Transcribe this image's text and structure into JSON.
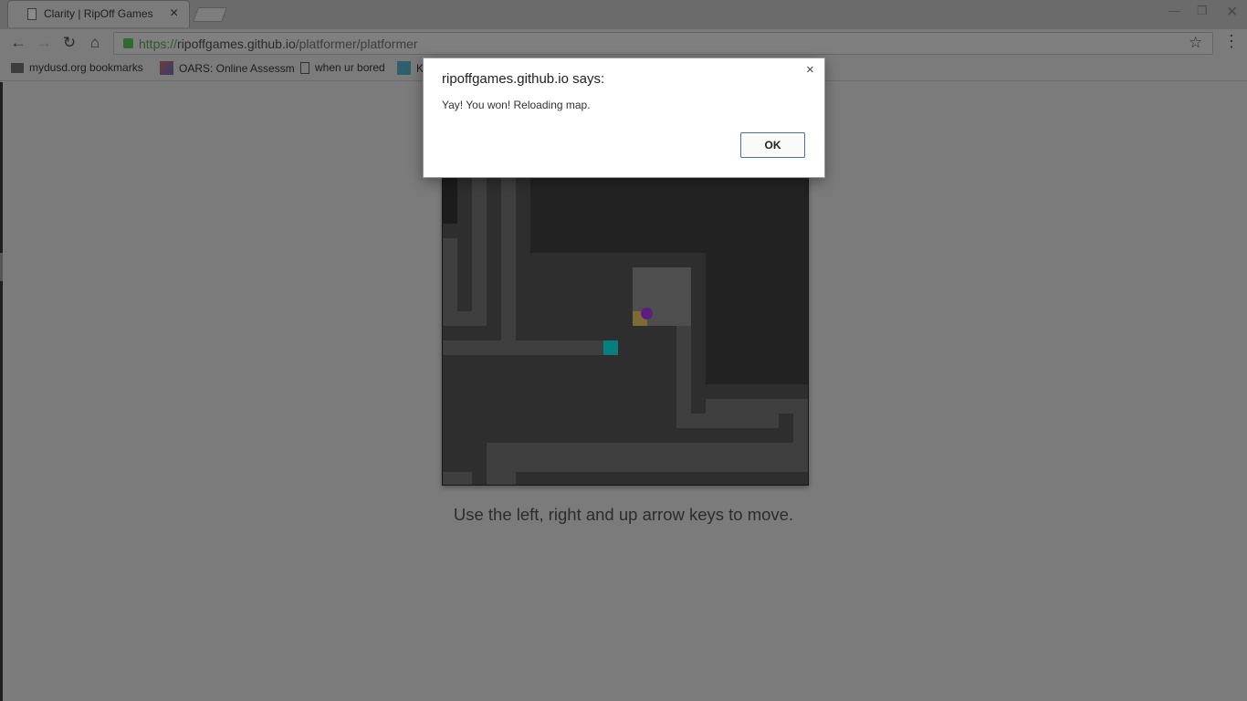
{
  "browser": {
    "tab_title": "Clarity | RipOff Games",
    "tab_close": "×",
    "url_scheme": "https://",
    "url_host": "ripoffgames.github.io",
    "url_path": "/platformer/platformer",
    "icons": {
      "back": "back-arrow-icon",
      "forward": "forward-arrow-icon",
      "reload": "reload-icon",
      "home": "home-icon",
      "lock": "lock-icon",
      "star": "star-icon",
      "menu": "kebab-menu-icon"
    },
    "bookmarks": [
      {
        "label": "mydusd.org bookmarks",
        "icon": "folder-icon"
      },
      {
        "label": "OARS: Online Assessm",
        "icon": "oars-favicon"
      },
      {
        "label": "when ur bored",
        "icon": "page-icon"
      },
      {
        "label": "K",
        "icon": "k-favicon"
      }
    ]
  },
  "game": {
    "colors": {
      "background": "#222222",
      "floor": "#2e2e2e",
      "wall": "#3f3f3f",
      "block": "#4e4e4e",
      "player": "#5a1f80",
      "goal": "#067f7f",
      "gold": "#7e6a33"
    },
    "instructions": "Use the left, right and up arrow keys to move."
  },
  "dialog": {
    "title": "ripoffgames.github.io says:",
    "message": "Yay! You won! Reloading map.",
    "ok_label": "OK",
    "close": "×"
  }
}
